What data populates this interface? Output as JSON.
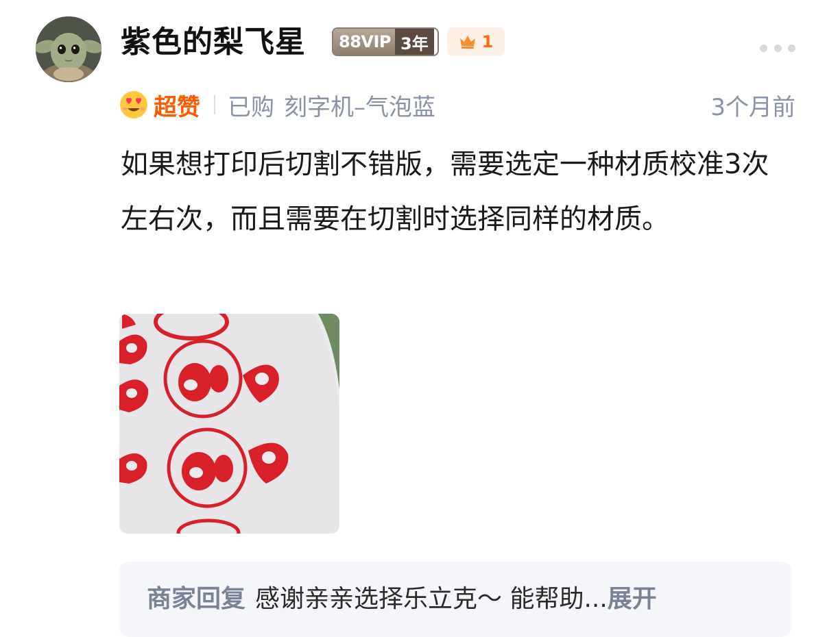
{
  "user": {
    "name": "紫色的梨飞星",
    "vip_label": "88VIP",
    "vip_years": "3年",
    "crown_count": "1",
    "avatar_icon": "baby-alien-avatar"
  },
  "rating": {
    "emoji_icon": "heart-eyes-emoji-icon",
    "label": "超赞",
    "accent_color": "#ff5a00"
  },
  "purchase": {
    "status": "已购",
    "sku": "刻字机–气泡蓝"
  },
  "time_ago": "3个月前",
  "review": {
    "text": "如果想打印后切割不错版，需要选定一种材质校准3次左右次，而且需要在切割时选择同样的材质。"
  },
  "photo": {
    "icon": "red-gourd-sticker-photo"
  },
  "merchant_reply": {
    "label": "商家回复",
    "text": "感谢亲亲选择乐立克～ 能帮助...",
    "expand_label": "展开"
  }
}
